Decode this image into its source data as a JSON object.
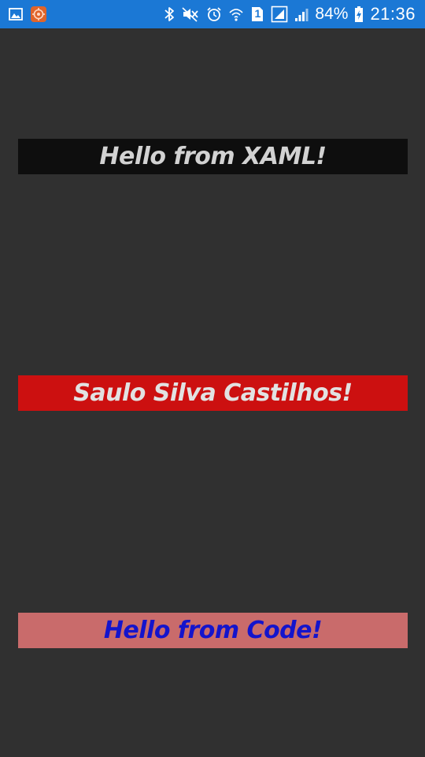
{
  "status_bar": {
    "battery_percent": "84%",
    "time": "21:36",
    "notification_badge": "1",
    "background_color": "#1b78d5",
    "left_icons": [
      "image-notification-icon",
      "app-notification-icon"
    ],
    "right_icons": [
      "bluetooth-icon",
      "mute-icon",
      "alarm-icon",
      "wifi-icon",
      "sim1-icon",
      "sim-signal-icon",
      "signal-icon",
      "battery-charging-icon"
    ]
  },
  "labels": {
    "xaml": {
      "text": "Hello from XAML!",
      "background": "#0e0e0e",
      "color": "#d2d2d2"
    },
    "name": {
      "text": "Saulo Silva Castilhos!",
      "background": "#cc1010",
      "color": "#e2e2e2"
    },
    "code": {
      "text": "Hello from Code!",
      "background": "#c96b6b",
      "color": "#1414cc"
    }
  },
  "page": {
    "background": "#303030"
  }
}
